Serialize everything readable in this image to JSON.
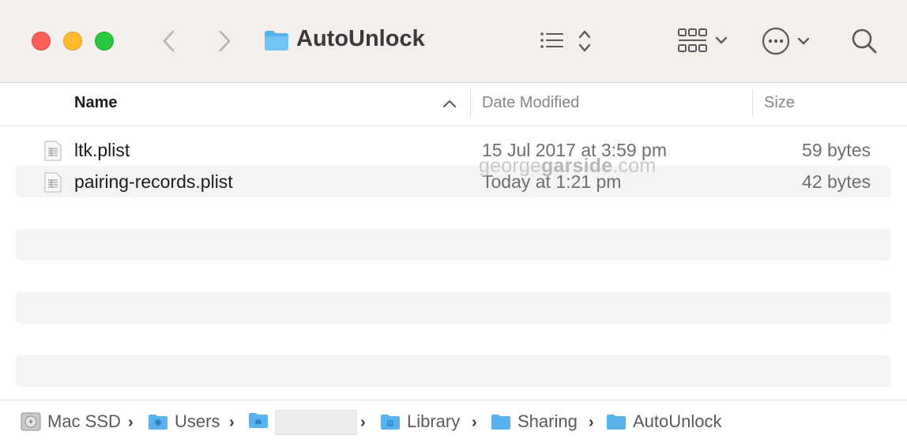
{
  "window": {
    "title": "AutoUnlock"
  },
  "toolbar": {
    "back_icon": "chevron-left-icon",
    "forward_icon": "chevron-right-icon",
    "view_icon": "list-view-icon",
    "group_icon": "icon-grid-icon",
    "more_icon": "ellipsis-circle-icon",
    "search_icon": "search-icon"
  },
  "columns": {
    "name": "Name",
    "date": "Date Modified",
    "size": "Size"
  },
  "files": [
    {
      "name": "ltk.plist",
      "date": "15 Jul 2017 at 3:59 pm",
      "size": "59 bytes"
    },
    {
      "name": "pairing-records.plist",
      "date": "Today at 1:21 pm",
      "size": "42 bytes"
    }
  ],
  "watermark": {
    "pre": "george",
    "bold": "garside",
    "post": ".com"
  },
  "pathbar": {
    "disk": "Mac SSD",
    "users": "Users",
    "library": "Library",
    "sharing": "Sharing",
    "current": "AutoUnlock"
  },
  "colors": {
    "red": "#ff5f57",
    "yellow": "#febc2e",
    "green": "#28c840",
    "folder": "#5ab2ec"
  }
}
